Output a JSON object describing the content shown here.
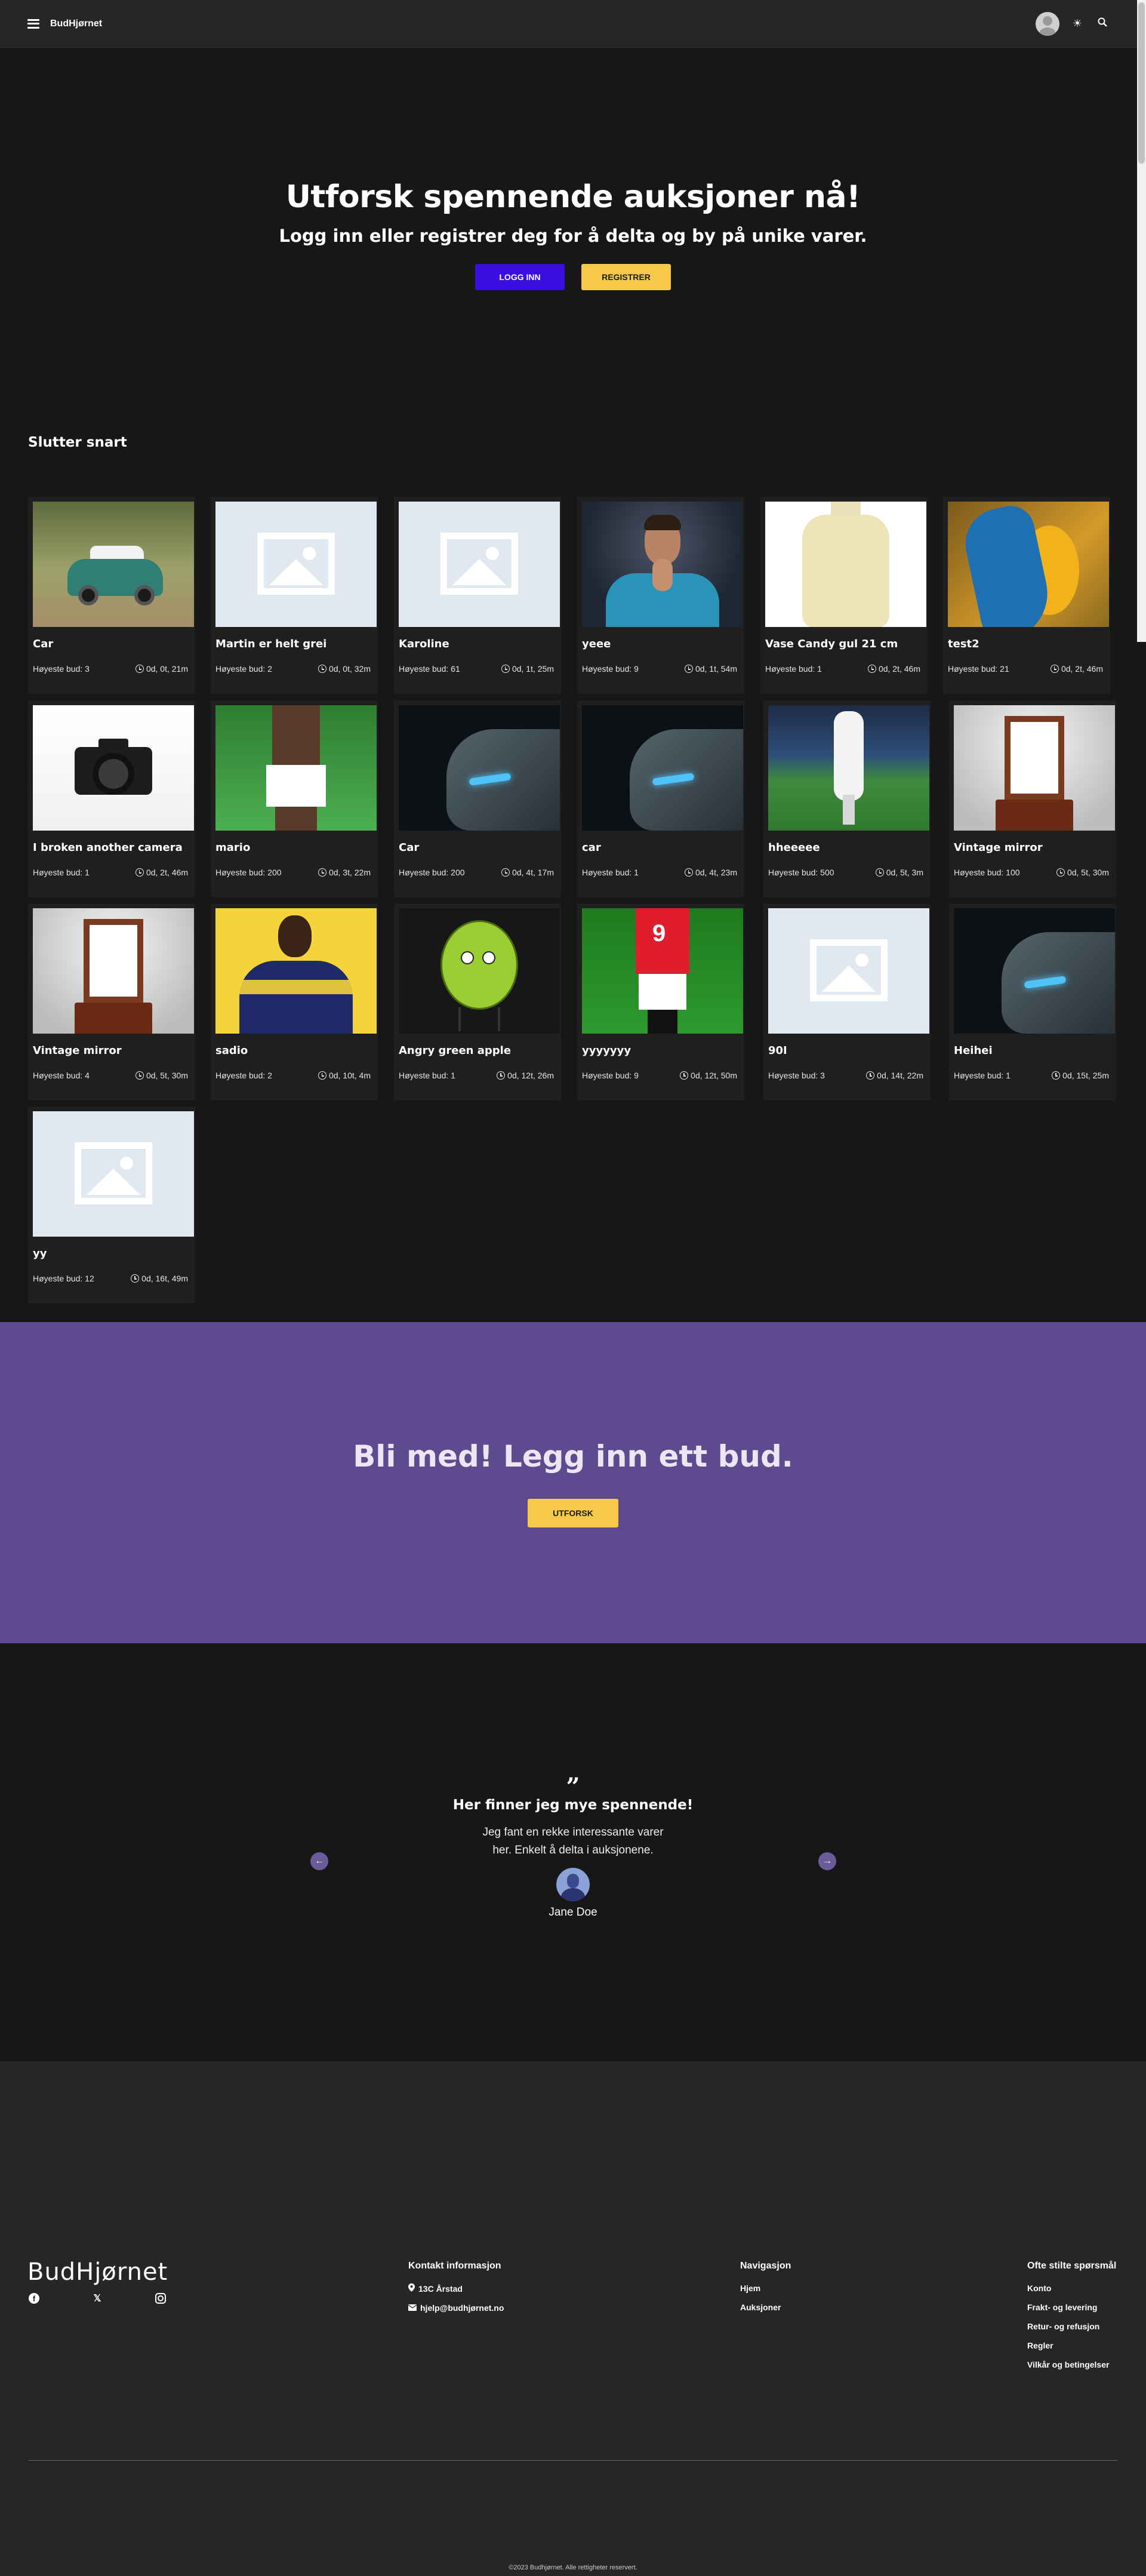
{
  "navbar": {
    "brand": "BudHjørnet",
    "menu_icon": "hamburger-icon",
    "theme_icon": "sun-icon",
    "search_icon": "search-icon"
  },
  "hero": {
    "title": "Utforsk spennende auksjoner nå!",
    "subtitle": "Logg inn eller registrer deg for å delta og by på unike varer.",
    "login_label": "LOGG INN",
    "register_label": "REGISTRER"
  },
  "section": {
    "title": "Slutter snart"
  },
  "bid_label": "Høyeste bud:",
  "auctions": [
    {
      "title": "Car",
      "bid": "3",
      "time": "0d, 0t, 21m",
      "image": "toy-car"
    },
    {
      "title": "Martin er helt grei",
      "bid": "2",
      "time": "0d, 0t, 32m",
      "image": "placeholder"
    },
    {
      "title": "Karoline",
      "bid": "61",
      "time": "0d, 1t, 25m",
      "image": "placeholder"
    },
    {
      "title": "yeee",
      "bid": "9",
      "time": "0d, 1t, 54m",
      "image": "ronaldo"
    },
    {
      "title": "Vase Candy gul 21 cm",
      "bid": "1",
      "time": "0d, 2t, 46m",
      "image": "vase"
    },
    {
      "title": "test2",
      "bid": "21",
      "time": "0d, 2t, 46m",
      "image": "parrot"
    },
    {
      "title": "I broken another camera",
      "bid": "1",
      "time": "0d, 2t, 46m",
      "image": "camera"
    },
    {
      "title": "mario",
      "bid": "200",
      "time": "0d, 3t, 22m",
      "image": "mario"
    },
    {
      "title": "Car",
      "bid": "200",
      "time": "0d, 4t, 17m",
      "image": "audi"
    },
    {
      "title": "car",
      "bid": "1",
      "time": "0d, 4t, 23m",
      "image": "audi"
    },
    {
      "title": "hheeeee",
      "bid": "500",
      "time": "0d, 5t, 3m",
      "image": "soccer"
    },
    {
      "title": "Vintage mirror",
      "bid": "100",
      "time": "0d, 5t, 30m",
      "image": "mirror"
    },
    {
      "title": "Vintage mirror",
      "bid": "4",
      "time": "0d, 5t, 30m",
      "image": "mirror"
    },
    {
      "title": "sadio",
      "bid": "2",
      "time": "0d, 10t, 4m",
      "image": "sadio"
    },
    {
      "title": "Angry green apple",
      "bid": "1",
      "time": "0d, 12t, 26m",
      "image": "apple"
    },
    {
      "title": "yyyyyyy",
      "bid": "9",
      "time": "0d, 12t, 50m",
      "image": "red-player"
    },
    {
      "title": "90I",
      "bid": "3",
      "time": "0d, 14t, 22m",
      "image": "placeholder"
    },
    {
      "title": "Heihei",
      "bid": "1",
      "time": "0d, 15t, 25m",
      "image": "audi"
    },
    {
      "title": "yy",
      "bid": "12",
      "time": "0d, 16t, 49m",
      "image": "placeholder"
    }
  ],
  "banner": {
    "title": "Bli med! Legg inn ett bud.",
    "button_label": "UTFORSK"
  },
  "testimonial": {
    "quote_mark": "”",
    "title": "Her finner jeg mye spennende!",
    "text": "Jeg fant en rekke interessante varer her. Enkelt å delta i auksjonene.",
    "name": "Jane Doe"
  },
  "footer": {
    "brand": "BudHjørnet",
    "contact": {
      "heading": "Kontakt informasjon",
      "address": "13C Årstad",
      "email": "hjelp@budhjørnet.no"
    },
    "navigation": {
      "heading": "Navigasjon",
      "items": [
        "Hjem",
        "Auksjoner"
      ]
    },
    "faq": {
      "heading": "Ofte stilte spørsmål",
      "items": [
        "Konto",
        "Frakt- og levering",
        "Retur- og refusjon",
        "Regler",
        "Vilkår og betingelser"
      ]
    },
    "copyright": "©2023 Budhjørnet. Alle rettigheter reservert."
  },
  "colors": {
    "background": "#171717",
    "navbar": "#262626",
    "primary_button": "#3a0ee0",
    "warning_button": "#f7c948",
    "banner": "#5d4a8f"
  }
}
